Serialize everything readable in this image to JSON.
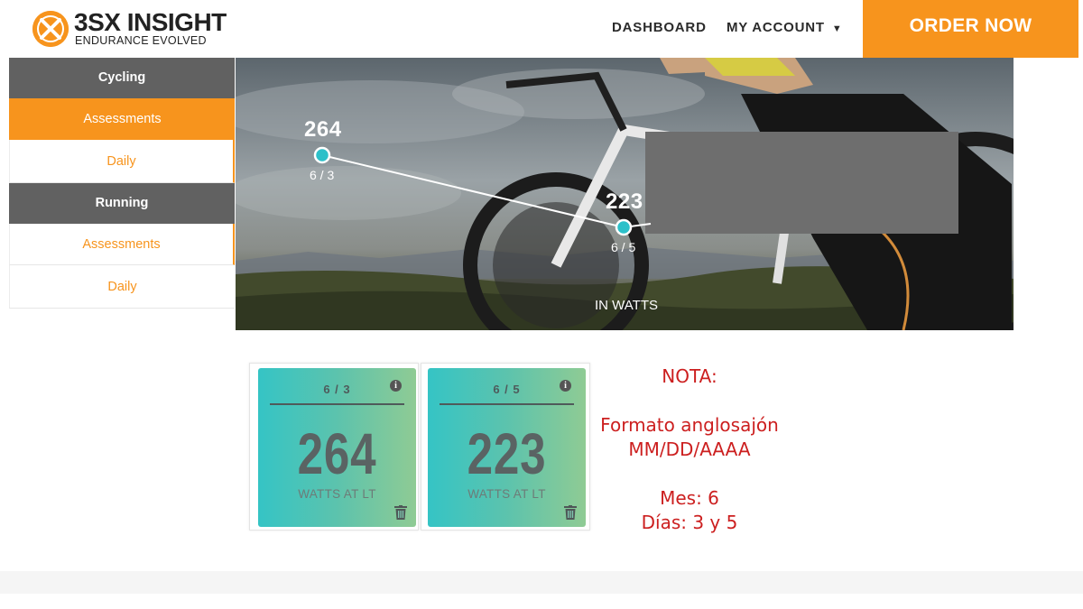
{
  "header": {
    "logo_name": "3SX INSIGHT",
    "logo_tagline": "ENDURANCE EVOLVED",
    "nav_dashboard": "DASHBOARD",
    "nav_account": "MY ACCOUNT",
    "order_button": "ORDER NOW"
  },
  "sidebar": {
    "cycling_header": "Cycling",
    "cycling_items": [
      "Assessments",
      "Daily"
    ],
    "running_header": "Running",
    "running_items": [
      "Assessments",
      "Daily"
    ],
    "active_item": "Cycling Assessments"
  },
  "chart": {
    "points": [
      {
        "value": "264",
        "date": "6 / 3"
      },
      {
        "value": "223",
        "date": "6 / 5"
      }
    ],
    "unit_label": "IN WATTS"
  },
  "chart_data": {
    "type": "line",
    "categories": [
      "6 / 3",
      "6 / 5"
    ],
    "series": [
      {
        "values": [
          264,
          223
        ]
      }
    ],
    "xlabel": "",
    "ylabel": "IN WATTS"
  },
  "cards": [
    {
      "date": "6 / 3",
      "value": "264",
      "label": "WATTS AT LT"
    },
    {
      "date": "6 / 5",
      "value": "223",
      "label": "WATTS AT LT"
    }
  ],
  "note": {
    "title": "NOTA:",
    "line1": "Formato anglosajón",
    "line2": "MM/DD/AAAA",
    "line3": "Mes: 6",
    "line4": "Días: 3 y 5"
  },
  "colors": {
    "brand_orange": "#f7941d",
    "sidebar_header": "#616161",
    "note_red": "#cc1f1f",
    "card_teal": "#35c4c5",
    "card_green": "#8fcb94"
  }
}
